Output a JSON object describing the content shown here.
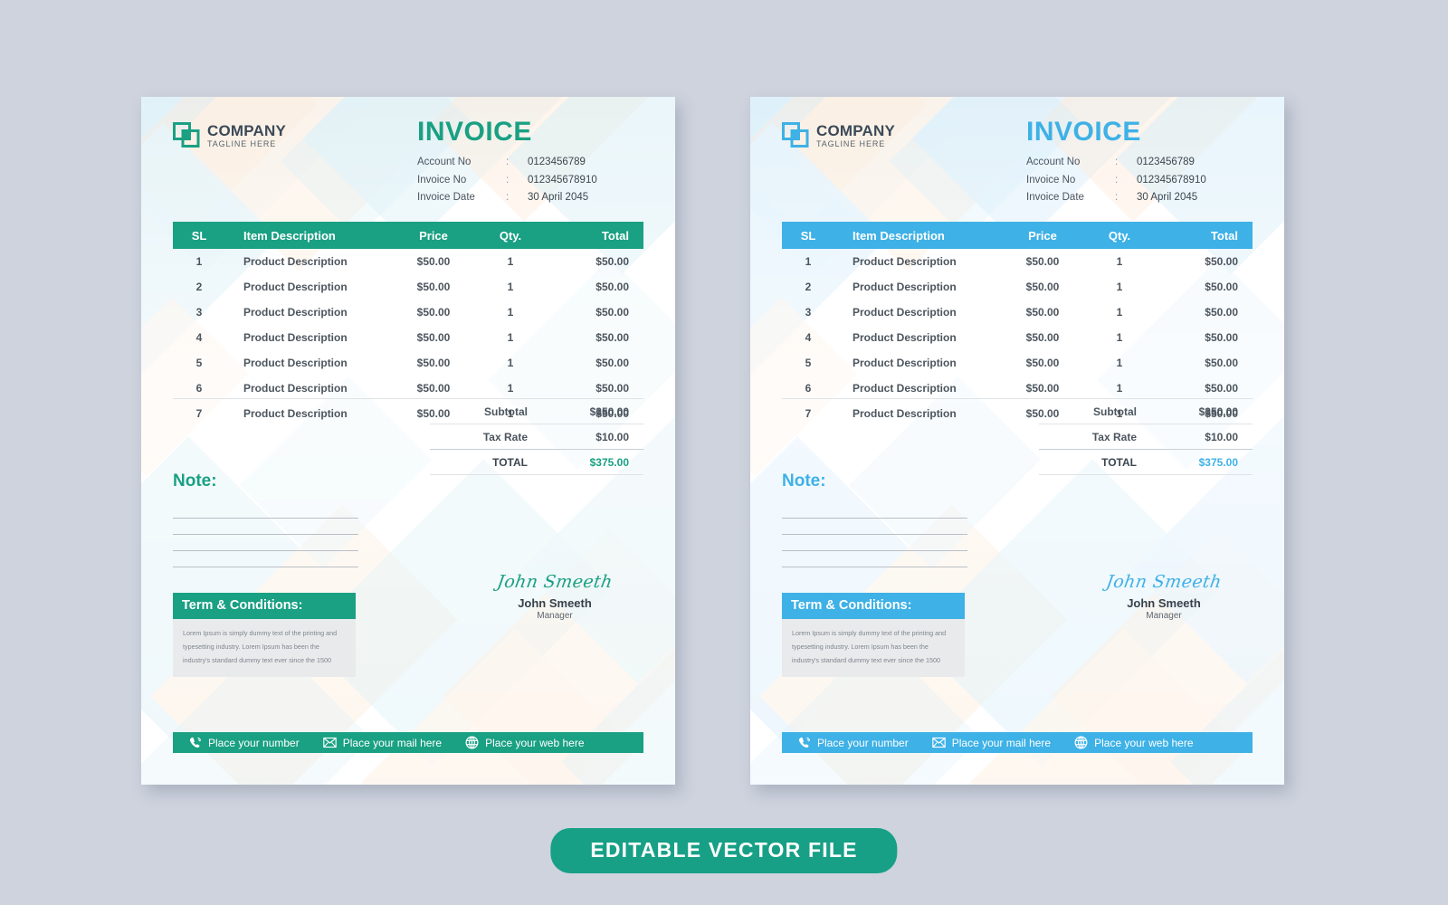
{
  "page": {
    "background_color": "#ced3de",
    "banner": {
      "label": "EDITABLE VECTOR  FILE",
      "color": "#17a086"
    }
  },
  "theme": {
    "green": "#1aa083",
    "blue": "#3eb1e6",
    "text_dark": "#3c464f",
    "text_body": "#4c555e",
    "rule": "#dfe3e6",
    "terms_bg": "#e9eaec"
  },
  "invoices": [
    {
      "variant": "green",
      "accent": "#1aa083",
      "logo": {
        "icon": "overlapping-squares-logo-icon",
        "name": "COMPANY",
        "tagline": "TAGLINE HERE"
      },
      "header": {
        "title": "INVOICE",
        "meta": [
          {
            "label": "Account No",
            "sep": ":",
            "value": "0123456789"
          },
          {
            "label": "Invoice No",
            "sep": ":",
            "value": "012345678910"
          },
          {
            "label": "Invoice Date",
            "sep": ":",
            "value": "30 April 2045"
          }
        ]
      },
      "table": {
        "columns": [
          "SL",
          "Item Description",
          "Price",
          "Qty.",
          "Total"
        ],
        "rows": [
          {
            "sl": "1",
            "desc": "Product Description",
            "price": "$50.00",
            "qty": "1",
            "total": "$50.00"
          },
          {
            "sl": "2",
            "desc": "Product Description",
            "price": "$50.00",
            "qty": "1",
            "total": "$50.00"
          },
          {
            "sl": "3",
            "desc": "Product Description",
            "price": "$50.00",
            "qty": "1",
            "total": "$50.00"
          },
          {
            "sl": "4",
            "desc": "Product Description",
            "price": "$50.00",
            "qty": "1",
            "total": "$50.00"
          },
          {
            "sl": "5",
            "desc": "Product Description",
            "price": "$50.00",
            "qty": "1",
            "total": "$50.00"
          },
          {
            "sl": "6",
            "desc": "Product Description",
            "price": "$50.00",
            "qty": "1",
            "total": "$50.00"
          },
          {
            "sl": "7",
            "desc": "Product Description",
            "price": "$50.00",
            "qty": "1",
            "total": "$50.00"
          }
        ]
      },
      "totals": [
        {
          "label": "Subtotal",
          "value": "$350.00"
        },
        {
          "label": "Tax Rate",
          "value": "$10.00"
        },
        {
          "label": "TOTAL",
          "value": "$375.00"
        }
      ],
      "note": {
        "heading": "Note:",
        "lines": 4
      },
      "terms": {
        "heading": "Term & Conditions:",
        "body": "Lorem Ipsum is simply dummy text of the printing and typesetting industry. Lorem Ipsum has been the industry's standard dummy text ever since the 1500"
      },
      "signature": {
        "script": "John Smeeth",
        "name": "John Smeeth",
        "role": "Manager"
      },
      "contact": [
        {
          "icon": "phone-icon",
          "label": "Place your number"
        },
        {
          "icon": "mail-icon",
          "label": "Place your mail here"
        },
        {
          "icon": "globe-icon",
          "label": "Place your web here"
        }
      ]
    },
    {
      "variant": "blue",
      "accent": "#3eb1e6",
      "logo": {
        "icon": "overlapping-squares-logo-icon",
        "name": "COMPANY",
        "tagline": "TAGLINE HERE"
      },
      "header": {
        "title": "INVOICE",
        "meta": [
          {
            "label": "Account No",
            "sep": ":",
            "value": "0123456789"
          },
          {
            "label": "Invoice No",
            "sep": ":",
            "value": "012345678910"
          },
          {
            "label": "Invoice Date",
            "sep": ":",
            "value": "30 April 2045"
          }
        ]
      },
      "table": {
        "columns": [
          "SL",
          "Item Description",
          "Price",
          "Qty.",
          "Total"
        ],
        "rows": [
          {
            "sl": "1",
            "desc": "Product Description",
            "price": "$50.00",
            "qty": "1",
            "total": "$50.00"
          },
          {
            "sl": "2",
            "desc": "Product Description",
            "price": "$50.00",
            "qty": "1",
            "total": "$50.00"
          },
          {
            "sl": "3",
            "desc": "Product Description",
            "price": "$50.00",
            "qty": "1",
            "total": "$50.00"
          },
          {
            "sl": "4",
            "desc": "Product Description",
            "price": "$50.00",
            "qty": "1",
            "total": "$50.00"
          },
          {
            "sl": "5",
            "desc": "Product Description",
            "price": "$50.00",
            "qty": "1",
            "total": "$50.00"
          },
          {
            "sl": "6",
            "desc": "Product Description",
            "price": "$50.00",
            "qty": "1",
            "total": "$50.00"
          },
          {
            "sl": "7",
            "desc": "Product Description",
            "price": "$50.00",
            "qty": "1",
            "total": "$50.00"
          }
        ]
      },
      "totals": [
        {
          "label": "Subtotal",
          "value": "$350.00"
        },
        {
          "label": "Tax Rate",
          "value": "$10.00"
        },
        {
          "label": "TOTAL",
          "value": "$375.00"
        }
      ],
      "note": {
        "heading": "Note:",
        "lines": 4
      },
      "terms": {
        "heading": "Term & Conditions:",
        "body": "Lorem Ipsum is simply dummy text of the printing and typesetting industry. Lorem Ipsum has been the industry's standard dummy text ever since the 1500"
      },
      "signature": {
        "script": "John Smeeth",
        "name": "John Smeeth",
        "role": "Manager"
      },
      "contact": [
        {
          "icon": "phone-icon",
          "label": "Place your number"
        },
        {
          "icon": "mail-icon",
          "label": "Place your mail here"
        },
        {
          "icon": "globe-icon",
          "label": "Place your web here"
        }
      ]
    }
  ]
}
